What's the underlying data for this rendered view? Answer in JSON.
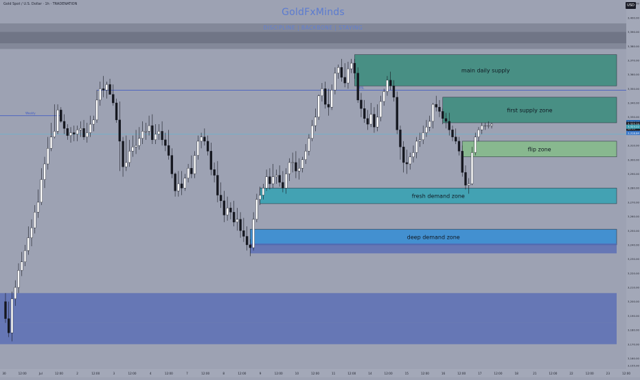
{
  "header": {
    "symbol_line": "Gold Spot / U.S. Dollar · 1h · TRADENATION",
    "brand": "GoldFxMinds",
    "tags": "DISCIPLINE | BACKBONE | STAYING",
    "currency_button": "USD"
  },
  "colors": {
    "background": "#9da2b3",
    "bull_candle": "#ffffff",
    "bear_candle": "#15171f",
    "supply_zone": "#3f8e80",
    "demand_zone": "#3aa2b3",
    "deep_demand_zone": "#3a8fd4",
    "flip_zone": "#86bb8c",
    "liquidity_band": "#5468b6",
    "key_level_line": "#3a56c4"
  },
  "chart_data": {
    "type": "candlestick",
    "timeframe": "1h",
    "ylim": [
      3152.5,
      3412.5
    ],
    "price_axis": [
      "3,410.00",
      "3,400.00",
      "3,390.00",
      "3,380.00",
      "3,370.00",
      "3,360.00",
      "3,350.00",
      "3,340.00",
      "3,330.00",
      "3,320.00",
      "3,310.00",
      "3,300.00",
      "3,290.00",
      "3,280.00",
      "3,270.00",
      "3,260.00",
      "3,250.00",
      "3,240.00",
      "3,230.00",
      "3,220.00",
      "3,210.00",
      "3,200.00",
      "3,190.00",
      "3,180.00",
      "3,170.00",
      "3,160.00",
      "3,155.00"
    ],
    "time_axis": [
      "30",
      "12:00",
      "Jul",
      "12:00",
      "2",
      "12:00",
      "3",
      "12:00",
      "4",
      "12:00",
      "7",
      "12:00",
      "8",
      "12:00",
      "9",
      "12:00",
      "10",
      "12:00",
      "11",
      "12:00",
      "14",
      "12:00",
      "15",
      "12:00",
      "16",
      "12:00",
      "17",
      "12:00",
      "18",
      "21",
      "12:00",
      "22",
      "12:00",
      "23",
      "12:00"
    ],
    "price_labels": [
      {
        "text": "3,326.49",
        "price": 3326.49,
        "role": "ask"
      },
      {
        "text": "3,325.24",
        "price": 3325.24,
        "role": "last"
      },
      {
        "text": "02:15",
        "price": 3321.8,
        "role": "countdown"
      },
      {
        "text": "3,323.22",
        "price": 3323.22,
        "role": "marker"
      },
      {
        "text": "3,318.84",
        "price": 3318.84,
        "role": "bid"
      }
    ],
    "zones": [
      {
        "label": "main daily supply",
        "kind": "supply",
        "price_low": 3352,
        "price_high": 3374,
        "start_index": 107,
        "end_index": 179
      },
      {
        "label": "first supply zone",
        "kind": "supply",
        "price_low": 3326,
        "price_high": 3344,
        "start_index": 134,
        "end_index": 179
      },
      {
        "label": "flip zone",
        "kind": "flip",
        "price_low": 3302,
        "price_high": 3313,
        "start_index": 140,
        "end_index": 179
      },
      {
        "label": "fresh demand zone",
        "kind": "demand",
        "price_low": 3269,
        "price_high": 3280,
        "start_index": 78,
        "end_index": 179
      },
      {
        "label": "deep demand zone",
        "kind": "deep_demand",
        "price_low": 3240,
        "price_high": 3251,
        "start_index": 75,
        "end_index": 179
      },
      {
        "label": "",
        "kind": "liquidity_band",
        "price_low": 3234,
        "price_high": 3241,
        "start_index": 75,
        "end_index": 179
      },
      {
        "label": "",
        "kind": "liquidity_band",
        "price_low": 3185,
        "price_high": 3206,
        "start_index": 0,
        "end_index": 179
      },
      {
        "label": "",
        "kind": "liquidity_band",
        "price_low": 3170,
        "price_high": 3185,
        "start_index": 0,
        "end_index": 179
      }
    ],
    "key_levels": [
      {
        "price": 3349,
        "start_index": 28,
        "end_index": 152,
        "label": "BSL"
      },
      {
        "price": 3331,
        "start_index": 0,
        "end_index": 17,
        "label": "Weekly"
      },
      {
        "price": 3318,
        "start_index": 0,
        "end_index": 179,
        "label": ""
      }
    ],
    "candles": {
      "open": [
        3200,
        3188,
        3178,
        3202,
        3210,
        3222,
        3228,
        3236,
        3245,
        3252,
        3263,
        3270,
        3286,
        3297,
        3308,
        3316,
        3320,
        3335,
        3327,
        3322,
        3317,
        3319,
        3318,
        3321,
        3322,
        3316,
        3319,
        3325,
        3328,
        3342,
        3350,
        3349,
        3353,
        3346,
        3340,
        3328,
        3313,
        3295,
        3298,
        3306,
        3309,
        3310,
        3315,
        3320,
        3320,
        3324,
        3314,
        3318,
        3320,
        3314,
        3310,
        3303,
        3290,
        3278,
        3283,
        3280,
        3287,
        3294,
        3290,
        3303,
        3313,
        3316,
        3313,
        3306,
        3293,
        3289,
        3275,
        3271,
        3261,
        3266,
        3263,
        3256,
        3258,
        3250,
        3246,
        3240,
        3238,
        3258,
        3272,
        3275,
        3280,
        3288,
        3283,
        3288,
        3289,
        3284,
        3280,
        3290,
        3298,
        3298,
        3292,
        3294,
        3300,
        3306,
        3315,
        3324,
        3330,
        3345,
        3350,
        3339,
        3337,
        3349,
        3361,
        3365,
        3358,
        3354,
        3364,
        3368,
        3361,
        3342,
        3336,
        3329,
        3325,
        3332,
        3323,
        3330,
        3341,
        3348,
        3356,
        3352,
        3344,
        3321,
        3309,
        3298,
        3297,
        3302,
        3305,
        3313,
        3314,
        3319,
        3323,
        3327,
        3339,
        3337,
        3334,
        3329,
        3327,
        3321,
        3316,
        3313,
        3306,
        3291,
        3282,
        3283,
        3305,
        3316,
        3321,
        3324,
        3324,
        3324
      ],
      "high": [
        3206,
        3200,
        3207,
        3215,
        3227,
        3235,
        3240,
        3253,
        3258,
        3268,
        3279,
        3294,
        3302,
        3316,
        3326,
        3339,
        3339,
        3337,
        3332,
        3325,
        3323,
        3324,
        3324,
        3327,
        3328,
        3326,
        3331,
        3331,
        3349,
        3355,
        3359,
        3355,
        3357,
        3353,
        3343,
        3341,
        3316,
        3317,
        3314,
        3317,
        3321,
        3323,
        3327,
        3326,
        3331,
        3332,
        3325,
        3325,
        3327,
        3319,
        3321,
        3308,
        3291,
        3292,
        3292,
        3290,
        3297,
        3303,
        3306,
        3317,
        3319,
        3322,
        3317,
        3312,
        3298,
        3299,
        3284,
        3278,
        3274,
        3270,
        3271,
        3266,
        3263,
        3259,
        3253,
        3244,
        3263,
        3276,
        3281,
        3283,
        3293,
        3294,
        3297,
        3293,
        3296,
        3292,
        3294,
        3301,
        3305,
        3306,
        3301,
        3302,
        3311,
        3318,
        3328,
        3336,
        3346,
        3354,
        3355,
        3350,
        3353,
        3365,
        3367,
        3371,
        3368,
        3369,
        3371,
        3371,
        3365,
        3347,
        3342,
        3335,
        3340,
        3337,
        3339,
        3345,
        3350,
        3359,
        3362,
        3356,
        3348,
        3324,
        3313,
        3307,
        3305,
        3310,
        3316,
        3319,
        3324,
        3328,
        3331,
        3340,
        3345,
        3342,
        3336,
        3333,
        3333,
        3324,
        3322,
        3316,
        3310,
        3296,
        3287,
        3309,
        3319,
        3323,
        3326,
        3326,
        3327,
        3326
      ],
      "low": [
        3185,
        3175,
        3172,
        3197,
        3206,
        3218,
        3225,
        3233,
        3239,
        3248,
        3259,
        3268,
        3280,
        3293,
        3306,
        3315,
        3318,
        3326,
        3318,
        3314,
        3312,
        3313,
        3313,
        3316,
        3314,
        3312,
        3316,
        3320,
        3326,
        3338,
        3344,
        3343,
        3346,
        3338,
        3326,
        3292,
        3288,
        3292,
        3295,
        3302,
        3304,
        3307,
        3311,
        3314,
        3317,
        3311,
        3311,
        3314,
        3310,
        3306,
        3300,
        3287,
        3274,
        3274,
        3275,
        3278,
        3284,
        3287,
        3287,
        3300,
        3308,
        3310,
        3303,
        3289,
        3284,
        3270,
        3266,
        3256,
        3257,
        3258,
        3253,
        3250,
        3245,
        3242,
        3236,
        3232,
        3236,
        3256,
        3268,
        3272,
        3278,
        3279,
        3280,
        3283,
        3281,
        3277,
        3276,
        3285,
        3291,
        3287,
        3286,
        3291,
        3297,
        3303,
        3313,
        3320,
        3328,
        3341,
        3336,
        3331,
        3335,
        3346,
        3357,
        3355,
        3351,
        3350,
        3361,
        3357,
        3340,
        3330,
        3326,
        3321,
        3323,
        3319,
        3320,
        3327,
        3338,
        3345,
        3349,
        3341,
        3318,
        3300,
        3291,
        3290,
        3293,
        3298,
        3301,
        3309,
        3311,
        3316,
        3320,
        3322,
        3334,
        3330,
        3325,
        3322,
        3317,
        3313,
        3311,
        3303,
        3288,
        3279,
        3276,
        3282,
        3303,
        3313,
        3318,
        3321,
        3322,
        3322
      ],
      "close": [
        3188,
        3178,
        3202,
        3210,
        3222,
        3228,
        3236,
        3245,
        3252,
        3263,
        3270,
        3286,
        3297,
        3308,
        3316,
        3320,
        3335,
        3327,
        3322,
        3317,
        3319,
        3318,
        3321,
        3322,
        3316,
        3319,
        3325,
        3328,
        3342,
        3350,
        3349,
        3353,
        3346,
        3340,
        3328,
        3313,
        3295,
        3298,
        3306,
        3309,
        3310,
        3315,
        3320,
        3320,
        3324,
        3314,
        3318,
        3320,
        3314,
        3310,
        3303,
        3290,
        3278,
        3283,
        3280,
        3287,
        3294,
        3290,
        3303,
        3313,
        3316,
        3313,
        3306,
        3293,
        3289,
        3275,
        3271,
        3261,
        3266,
        3263,
        3256,
        3258,
        3250,
        3246,
        3240,
        3238,
        3258,
        3272,
        3275,
        3280,
        3288,
        3283,
        3288,
        3289,
        3284,
        3280,
        3290,
        3298,
        3298,
        3292,
        3294,
        3300,
        3306,
        3315,
        3324,
        3330,
        3345,
        3350,
        3339,
        3337,
        3349,
        3361,
        3365,
        3358,
        3354,
        3364,
        3368,
        3361,
        3342,
        3336,
        3329,
        3325,
        3332,
        3323,
        3330,
        3341,
        3348,
        3356,
        3352,
        3344,
        3321,
        3309,
        3298,
        3297,
        3302,
        3305,
        3313,
        3314,
        3319,
        3323,
        3327,
        3339,
        3337,
        3334,
        3329,
        3327,
        3321,
        3316,
        3313,
        3306,
        3291,
        3282,
        3283,
        3305,
        3316,
        3321,
        3324,
        3324,
        3324,
        3325
      ]
    }
  }
}
